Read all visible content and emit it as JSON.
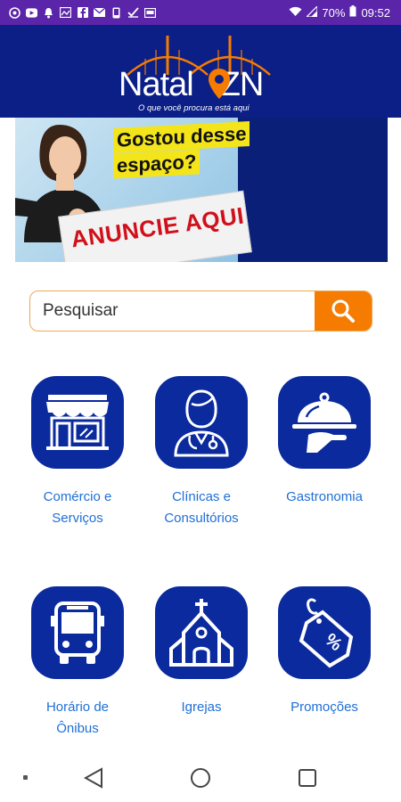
{
  "status_bar": {
    "battery": "70%",
    "time": "09:52",
    "left_icons": [
      "whatsapp-icon",
      "youtube-icon",
      "bell-icon",
      "image-icon",
      "facebook-icon",
      "gmail-icon",
      "phone-icon",
      "check-icon",
      "screen-icon"
    ]
  },
  "header": {
    "logo_left": "Natal",
    "logo_right": "ZN",
    "tagline": "O que você procura está aqui",
    "colors": {
      "bg": "#0b1f86",
      "accent": "#f57c00"
    }
  },
  "banner": {
    "headline_line1": "Gostou desse",
    "headline_line2": "espaço?",
    "cta": "ANUNCIE AQUI"
  },
  "search": {
    "placeholder": "Pesquisar",
    "button_color": "#f57c00"
  },
  "categories": [
    {
      "line1": "Comércio e",
      "line2": "Serviços",
      "icon": "storefront-icon"
    },
    {
      "line1": "Clínicas e",
      "line2": "Consultórios",
      "icon": "doctor-icon"
    },
    {
      "line1": "Gastronomia",
      "line2": "",
      "icon": "cloche-icon"
    },
    {
      "line1": "Horário de",
      "line2": "Ônibus",
      "icon": "bus-icon"
    },
    {
      "line1": "Igrejas",
      "line2": "",
      "icon": "church-icon"
    },
    {
      "line1": "Promoções",
      "line2": "",
      "icon": "price-tag-icon"
    }
  ],
  "nav": [
    "back-icon",
    "home-icon",
    "recents-icon"
  ]
}
